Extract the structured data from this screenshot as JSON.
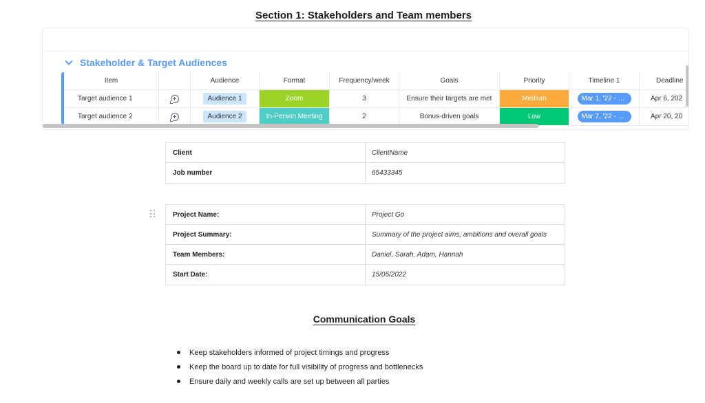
{
  "section_title": "Section 1: Stakeholders and Team members",
  "board": {
    "group_title": "Stakeholder & Target Audiences",
    "group_color": "#579bfc",
    "columns": {
      "item": "Item",
      "audience": "Audience",
      "format": "Format",
      "frequency": "Frequency/week",
      "goals": "Goals",
      "priority": "Priority",
      "timeline": "Timeline 1",
      "deadline": "Deadline"
    },
    "rows": [
      {
        "item": "Target audience 1",
        "audience": "Audience 1",
        "format": "Zoom",
        "format_color": "#9cd326",
        "frequency": "3",
        "goals": "Ensure their targets are met",
        "priority": "Medium",
        "priority_color": "#fdab3d",
        "timeline": "Mar 1, '22 - M...",
        "deadline": "Apr 6, 202"
      },
      {
        "item": "Target audience 2",
        "audience": "Audience 2",
        "format": "In-Person Meeting",
        "format_color": "#4eccc6",
        "frequency": "2",
        "goals": "Bonus-driven goals",
        "priority": "Low",
        "priority_color": "#00c875",
        "timeline": "Mar 7, '22 - ...",
        "deadline": "Apr 20, 20"
      }
    ]
  },
  "client_table": [
    {
      "key": "Client",
      "value": "ClientName"
    },
    {
      "key": "Job number",
      "value": "65433345"
    }
  ],
  "project_table": [
    {
      "key": "Project Name:",
      "value": "Project Go"
    },
    {
      "key": "Project Summary:",
      "value": "Summary of the project aims, ambitions and overall goals"
    },
    {
      "key": "Team Members:",
      "value": "Daniel, Sarah, Adam, Hannah"
    },
    {
      "key": "Start Date:",
      "value": "15/05/2022"
    }
  ],
  "communication": {
    "title": "Communication Goals",
    "bullets": [
      "Keep stakeholders informed of project timings and progress",
      "Keep the board up to date for full visibility of progress and bottlenecks",
      "Ensure daily and weekly calls are set up between all parties"
    ]
  }
}
